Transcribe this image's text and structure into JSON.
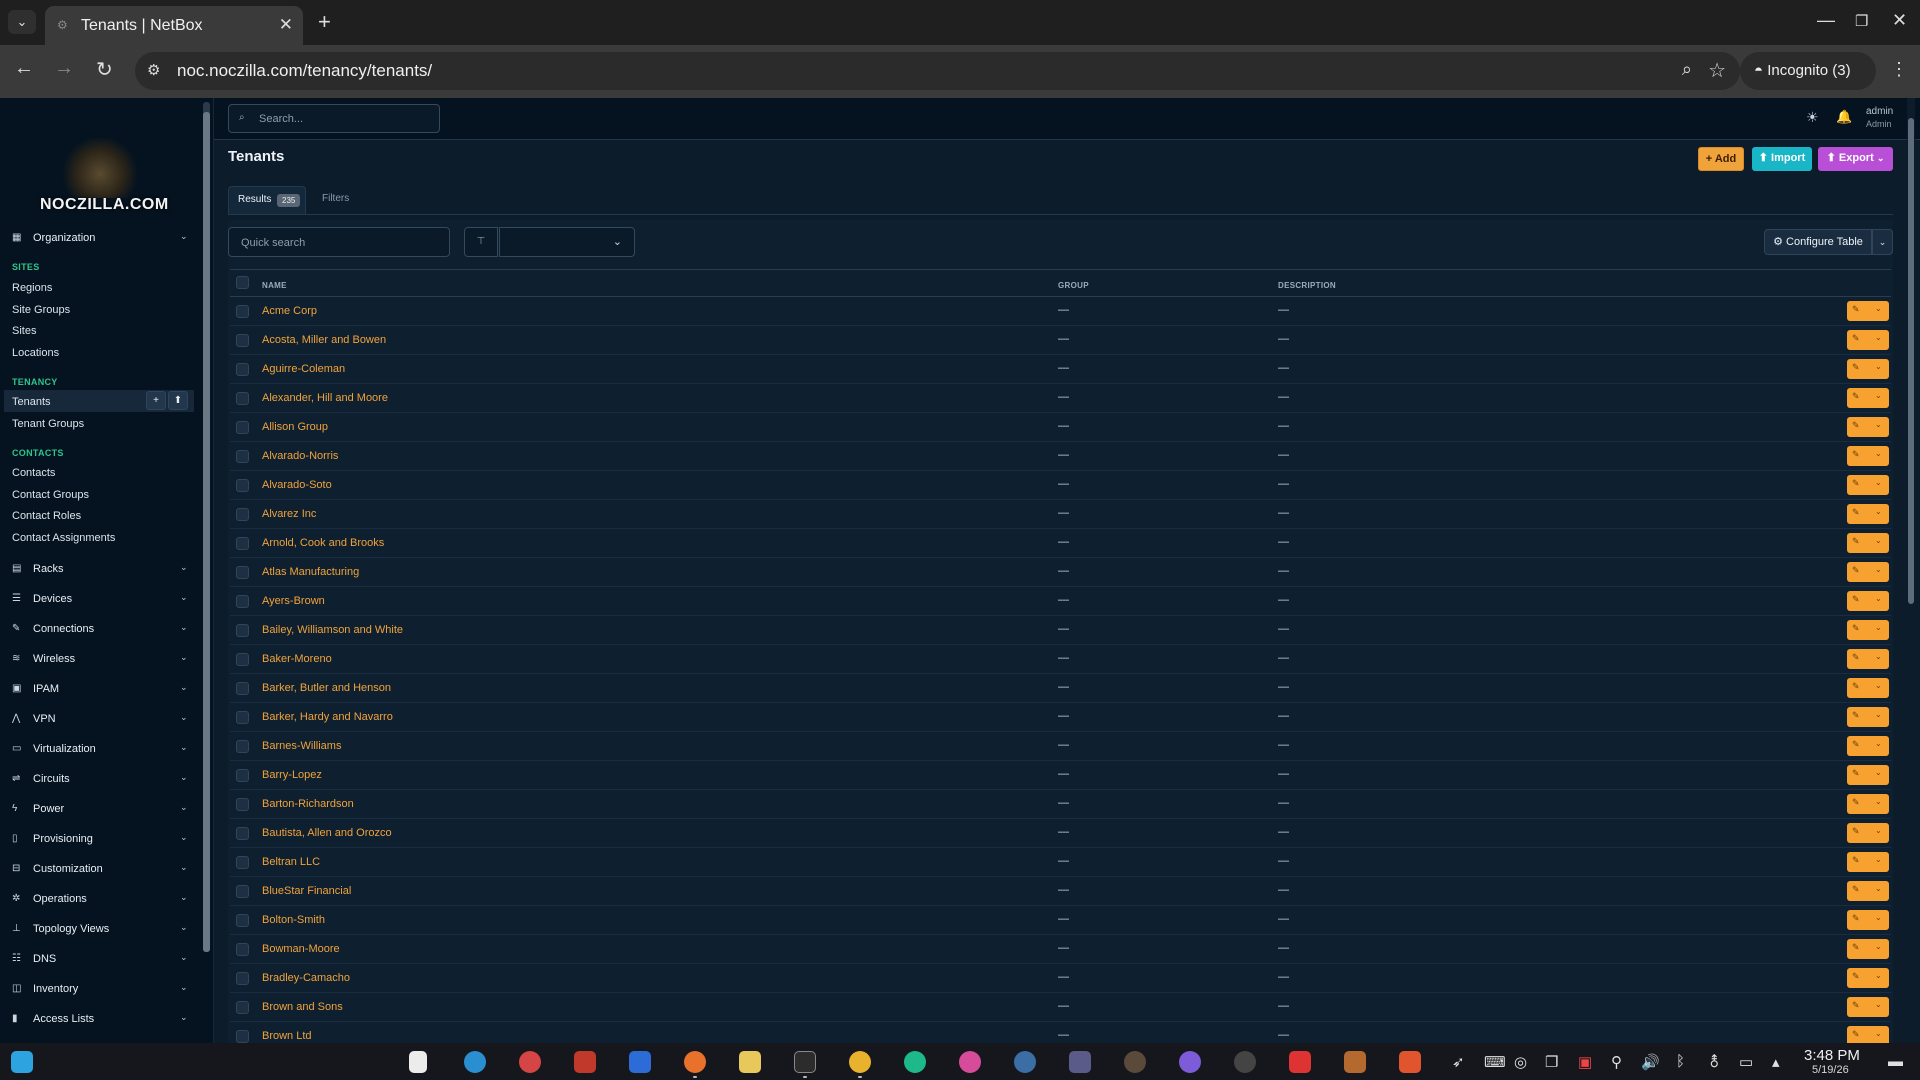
{
  "browser": {
    "tab_title": "Tenants | NetBox",
    "url": "noc.noczilla.com/tenancy/tenants/",
    "incognito_label": "Incognito (3)"
  },
  "logo_text": "NOCZILLA.COM",
  "sidebar": {
    "organization": "Organization",
    "sites_header": "SITES",
    "sites_items": [
      "Regions",
      "Site Groups",
      "Sites",
      "Locations"
    ],
    "tenancy_header": "TENANCY",
    "tenancy_items": [
      "Tenants",
      "Tenant Groups"
    ],
    "contacts_header": "CONTACTS",
    "contacts_items": [
      "Contacts",
      "Contact Groups",
      "Contact Roles",
      "Contact Assignments"
    ],
    "sections": [
      "Racks",
      "Devices",
      "Connections",
      "Wireless",
      "IPAM",
      "VPN",
      "Virtualization",
      "Circuits",
      "Power",
      "Provisioning",
      "Customization",
      "Operations",
      "Topology Views",
      "DNS",
      "Inventory",
      "Access Lists"
    ]
  },
  "header": {
    "search_placeholder": "Search...",
    "user_name": "admin",
    "user_role": "Admin"
  },
  "page": {
    "title": "Tenants",
    "add_label": "+ Add",
    "import_label": "⬆ Import",
    "export_label": "⬆ Export",
    "results_label": "Results",
    "results_count": "235",
    "filters_label": "Filters",
    "quick_search_placeholder": "Quick search",
    "configure_label": "⚙ Configure Table"
  },
  "table": {
    "columns": [
      "NAME",
      "GROUP",
      "DESCRIPTION"
    ],
    "rows": [
      {
        "name": "Acme Corp",
        "group": "—",
        "description": "—"
      },
      {
        "name": "Acosta, Miller and Bowen",
        "group": "—",
        "description": "—"
      },
      {
        "name": "Aguirre-Coleman",
        "group": "—",
        "description": "—"
      },
      {
        "name": "Alexander, Hill and Moore",
        "group": "—",
        "description": "—"
      },
      {
        "name": "Allison Group",
        "group": "—",
        "description": "—"
      },
      {
        "name": "Alvarado-Norris",
        "group": "—",
        "description": "—"
      },
      {
        "name": "Alvarado-Soto",
        "group": "—",
        "description": "—"
      },
      {
        "name": "Alvarez Inc",
        "group": "—",
        "description": "—"
      },
      {
        "name": "Arnold, Cook and Brooks",
        "group": "—",
        "description": "—"
      },
      {
        "name": "Atlas Manufacturing",
        "group": "—",
        "description": "—"
      },
      {
        "name": "Ayers-Brown",
        "group": "—",
        "description": "—"
      },
      {
        "name": "Bailey, Williamson and White",
        "group": "—",
        "description": "—"
      },
      {
        "name": "Baker-Moreno",
        "group": "—",
        "description": "—"
      },
      {
        "name": "Barker, Butler and Henson",
        "group": "—",
        "description": "—"
      },
      {
        "name": "Barker, Hardy and Navarro",
        "group": "—",
        "description": "—"
      },
      {
        "name": "Barnes-Williams",
        "group": "—",
        "description": "—"
      },
      {
        "name": "Barry-Lopez",
        "group": "—",
        "description": "—"
      },
      {
        "name": "Barton-Richardson",
        "group": "—",
        "description": "—"
      },
      {
        "name": "Bautista, Allen and Orozco",
        "group": "—",
        "description": "—"
      },
      {
        "name": "Beltran LLC",
        "group": "—",
        "description": "—"
      },
      {
        "name": "BlueStar Financial",
        "group": "—",
        "description": "—"
      },
      {
        "name": "Bolton-Smith",
        "group": "—",
        "description": "—"
      },
      {
        "name": "Bowman-Moore",
        "group": "—",
        "description": "—"
      },
      {
        "name": "Bradley-Camacho",
        "group": "—",
        "description": "—"
      },
      {
        "name": "Brown and Sons",
        "group": "—",
        "description": "—"
      },
      {
        "name": "Brown Ltd",
        "group": "—",
        "description": "—"
      }
    ]
  },
  "taskbar": {
    "time": "3:48 PM",
    "date": "5/19/26"
  }
}
